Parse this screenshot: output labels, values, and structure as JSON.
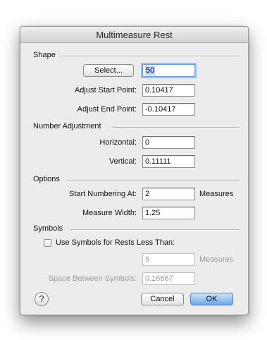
{
  "dialog": {
    "title": "Multimeasure Rest"
  },
  "shape": {
    "section": "Shape",
    "select_button": "Select...",
    "shape_value": "50",
    "adjust_start_label": "Adjust Start Point:",
    "adjust_start_value": "0.10417",
    "adjust_end_label": "Adjust End Point:",
    "adjust_end_value": "-0.10417"
  },
  "number_adjustment": {
    "section": "Number Adjustment",
    "horizontal_label": "Horizontal:",
    "horizontal_value": "0",
    "vertical_label": "Vertical:",
    "vertical_value": "0.11111"
  },
  "options": {
    "section": "Options",
    "start_numbering_label": "Start Numbering At:",
    "start_numbering_value": "2",
    "start_numbering_unit": "Measures",
    "measure_width_label": "Measure Width:",
    "measure_width_value": "1.25"
  },
  "symbols": {
    "section": "Symbols",
    "use_symbols_label": "Use Symbols for Rests Less Than:",
    "use_symbols_checked": false,
    "threshold_value": "9",
    "threshold_unit": "Measures",
    "space_between_label": "Space Between Symbols:",
    "space_between_value": "0.16667"
  },
  "footer": {
    "help_glyph": "?",
    "cancel_label": "Cancel",
    "ok_label": "OK"
  }
}
